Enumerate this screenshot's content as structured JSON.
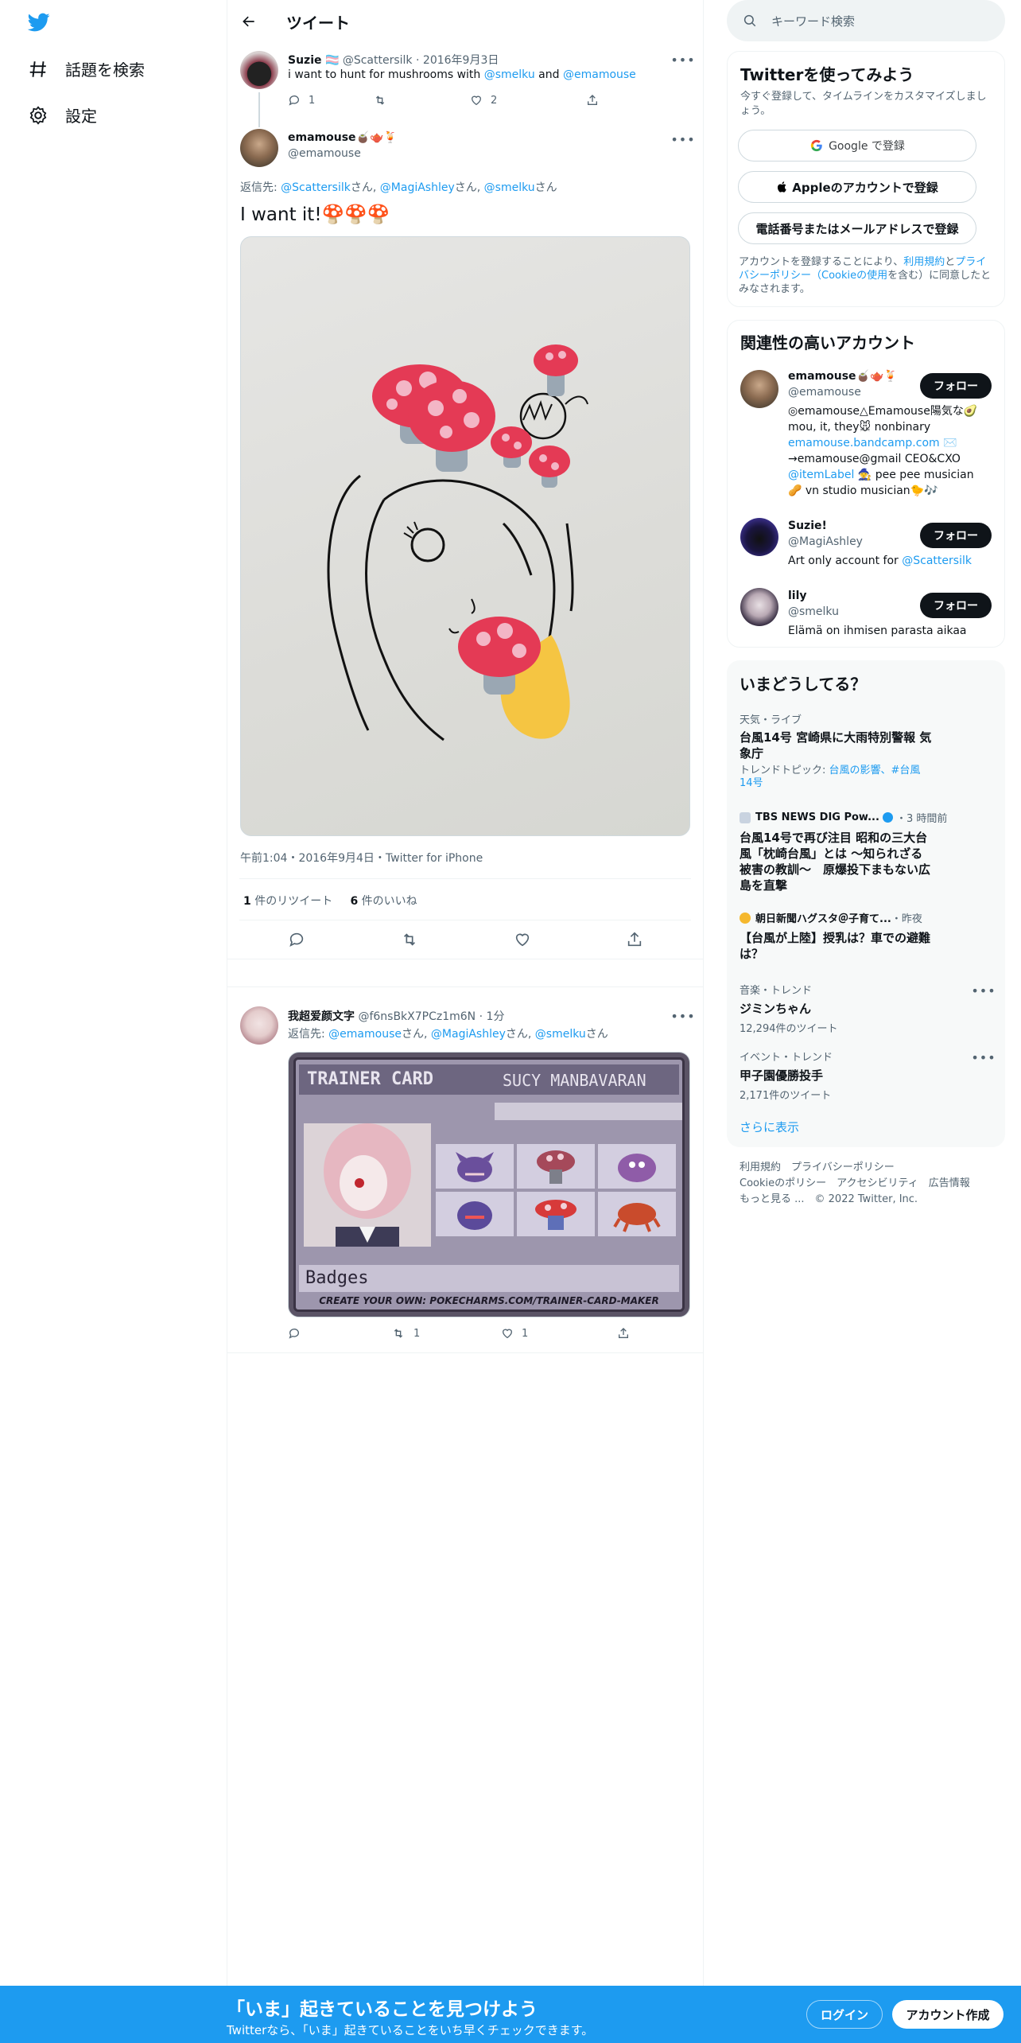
{
  "nav": {
    "explore_label": "話題を検索",
    "settings_label": "設定"
  },
  "header": {
    "title": "ツイート"
  },
  "parent_tweet": {
    "display_name": "Suzie",
    "flag": "🏳️‍⚧️",
    "handle": "@Scattersilk",
    "date": "2016年9月3日",
    "text_prefix": "i want to hunt for mushrooms with ",
    "mention1": "@smelku",
    "text_mid": " and ",
    "mention2": "@emamouse",
    "reply_count": "1",
    "retweet_count": "",
    "like_count": "2"
  },
  "main_tweet": {
    "display_name": "emamouse🧉🫖🍹",
    "handle": "@emamouse",
    "reply_to_label": "返信先: ",
    "reply_to_1": "@Scattersilk",
    "reply_to_2": "@MagiAshley",
    "reply_to_3": "@smelku",
    "san": "さん",
    "sep": ", ",
    "text": "I want it!🍄🍄🍄",
    "timestamp": "午前1:04・2016年9月4日・Twitter for iPhone",
    "retweets_num": "1",
    "retweets_label": " 件のリツイート",
    "likes_num": "6",
    "likes_label": " 件のいいね"
  },
  "reply_tweet": {
    "display_name": "我超爱颜文字",
    "handle": "@f6nsBkX7PCz1m6N",
    "time": "1分",
    "reply_to_label": "返信先: ",
    "reply_to_1": "@emamouse",
    "reply_to_2": "@MagiAshley",
    "reply_to_3": "@smelku",
    "san": "さん",
    "sep": ", ",
    "card_title": "TRAINER CARD",
    "card_name": "SUCY MANBAVARAN",
    "card_badges": "Badges",
    "card_footer": "CREATE YOUR OWN: POKECHARMS.COM/TRAINER-CARD-MAKER",
    "reply_count": "",
    "retweet_count": "1",
    "like_count": "1"
  },
  "search": {
    "placeholder": "キーワード検索"
  },
  "signup": {
    "title": "Twitterを使ってみよう",
    "subtitle": "今すぐ登録して、タイムラインをカスタマイズしましょう。",
    "google": "Google で登録",
    "apple": "Appleのアカウントで登録",
    "phone": "電話番号またはメールアドレスで登録",
    "terms_1": "アカウントを登録することにより、",
    "terms_link1": "利用規約",
    "terms_2": "と",
    "terms_link2": "プライバシーポリシー（Cookieの使用",
    "terms_3": "を含む）に同意したとみなされます。"
  },
  "related": {
    "title": "関連性の高いアカウント",
    "follow_label": "フォロー",
    "accounts": [
      {
        "name": "emamouse🧉🫖🍹",
        "handle": "@emamouse",
        "bio_1": "◎emamouse△Emamouse陽気な🥑 mou, it, they🐭 nonbinary",
        "bio_link": "emamouse.bandcamp.com",
        "bio_2": " ✉️ →emamouse@gmail CEO&CXO",
        "bio_link2": "@itemLabel",
        "bio_3": " 🧙 pee pee musician🥜 vn studio musician🐤🎶"
      },
      {
        "name": "Suzie!",
        "handle": "@MagiAshley",
        "bio_1": "Art only account for ",
        "bio_link": "@Scattersilk"
      },
      {
        "name": "lily",
        "handle": "@smelku",
        "bio_1": "Elämä on ihmisen parasta aikaa"
      }
    ]
  },
  "trends": {
    "title": "いまどうしてる？",
    "items": [
      {
        "meta": "天気・ライブ",
        "title": "台風14号 宮崎県に大雨特別警報 気象庁",
        "topic_label": "トレンドトピック: ",
        "topic_links": "台風の影響、#台風14号"
      },
      {
        "source": "TBS NEWS DIG Pow...",
        "time": "・3 時間前",
        "title": "台風14号で再び注目 昭和の三大台風「枕崎台風」とは ～知られざる被害の教訓～　原爆投下まもない広島を直撃"
      },
      {
        "source": "朝日新聞ハグスタ＠子育て...",
        "time": "・昨夜",
        "title": "【台風が上陸】授乳は？車での避難は？"
      },
      {
        "meta": "音楽・トレンド",
        "title": "ジミンちゃん",
        "count": "12,294件のツイート"
      },
      {
        "meta": "イベント・トレンド",
        "title": "甲子園優勝投手",
        "count": "2,171件のツイート"
      }
    ],
    "show_more": "さらに表示"
  },
  "footer_links": {
    "line1": "利用規約　プライバシーポリシー",
    "line2": "Cookieのポリシー　アクセシビリティ　広告情報",
    "line3": "もっと見る ...　© 2022 Twitter, Inc."
  },
  "bottom": {
    "title": "「いま」起きていることを見つけよう",
    "subtitle": "Twitterなら、「いま」起きていることをいち早くチェックできます。",
    "login": "ログイン",
    "signup": "アカウント作成"
  },
  "colors": {
    "accent": "#1d9bf0",
    "text": "#0f1419",
    "secondary": "#536471"
  }
}
